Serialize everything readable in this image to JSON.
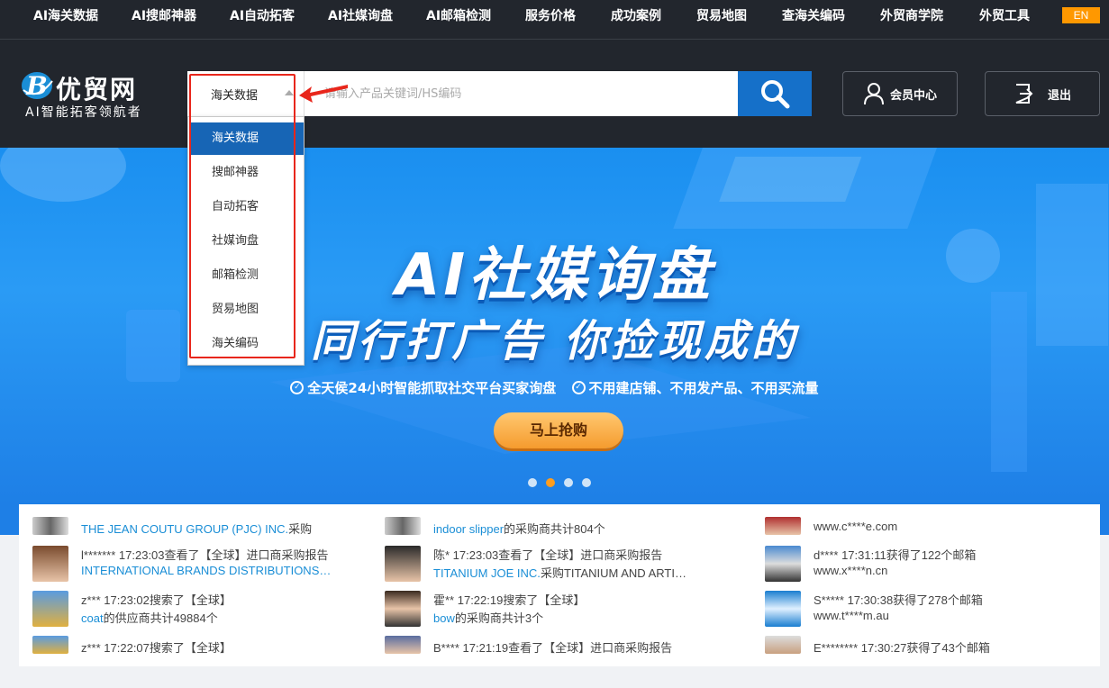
{
  "nav": {
    "items": [
      "AI海关数据",
      "AI搜邮神器",
      "AI自动拓客",
      "AI社媒询盘",
      "AI邮箱检测",
      "服务价格",
      "成功案例",
      "贸易地图",
      "查海关编码",
      "外贸商学院",
      "外贸工具"
    ],
    "lang": "EN"
  },
  "logo": {
    "name": "优贸网",
    "slogan": "AI智能拓客领航者"
  },
  "search": {
    "category": "海关数据",
    "placeholder": "请输入产品关键词/HS编码"
  },
  "header": {
    "member_label": "会员中心",
    "logout_label": "退出"
  },
  "dropdown": {
    "items": [
      "海关数据",
      "搜邮神器",
      "自动拓客",
      "社媒询盘",
      "邮箱检测",
      "贸易地图",
      "海关编码"
    ],
    "selected_index": 0
  },
  "banner": {
    "title": "AI社媒询盘",
    "subtitle": "同行打广告 你捡现成的",
    "features": [
      "全天侯24小时智能抓取社交平台买家询盘",
      "不用建店铺、不用发产品、不用买流量"
    ],
    "button": "马上抢购",
    "slides_total": 4,
    "active_slide": 1
  },
  "feed": {
    "col1": [
      {
        "l1a": "THE JEAN COUTU GROUP (PJC) INC.",
        "l1b": "采购",
        "l2": ""
      },
      {
        "l1": "l******* 17:23:03查看了【全球】进口商采购报告",
        "l2": "INTERNATIONAL BRANDS DISTRIBUTIONS…"
      },
      {
        "l1": "z*** 17:23:02搜索了【全球】",
        "l2a": "coat",
        "l2b": "的供应商共计49884个"
      },
      {
        "l1": "z*** 17:22:07搜索了【全球】",
        "l2": ""
      }
    ],
    "col2": [
      {
        "l1a": "indoor slipper",
        "l1b": "的采购商共计804个",
        "l2": ""
      },
      {
        "l1": "陈* 17:23:03查看了【全球】进口商采购报告",
        "l2a": "TITANIUM JOE INC.",
        "l2b": "采购TITANIUM AND ARTI…"
      },
      {
        "l1": "霍** 17:22:19搜索了【全球】",
        "l2a": "bow",
        "l2b": "的采购商共计3个"
      },
      {
        "l1": "B**** 17:21:19查看了【全球】进口商采购报告",
        "l2": ""
      }
    ],
    "col3": [
      {
        "l1": "www.c****e.com",
        "l2": ""
      },
      {
        "l1": "d**** 17:31:11获得了122个邮箱",
        "l2": "www.x****n.cn"
      },
      {
        "l1": "S***** 17:30:38获得了278个邮箱",
        "l2": "www.t****m.au"
      },
      {
        "l1": "E******** 17:30:27获得了43个邮箱",
        "l2": ""
      }
    ]
  },
  "colors": {
    "nav_bg": "#22262d",
    "accent": "#1570c9",
    "en_bg": "#ff9800",
    "highlight": "#e8261b"
  }
}
